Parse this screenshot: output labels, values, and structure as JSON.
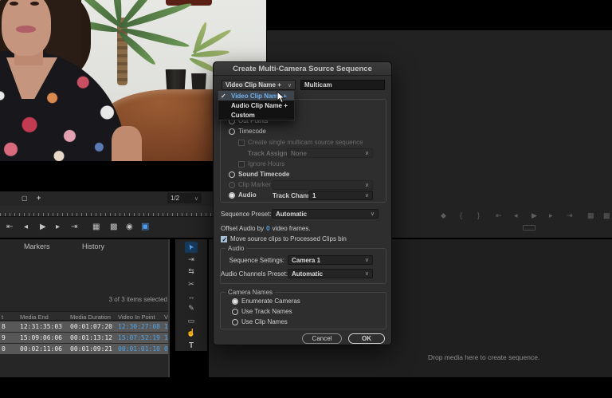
{
  "colors": {
    "accent_blue": "#4fa3e8",
    "menu_highlight_text": "#6fb1ef",
    "row_selected": "#585858",
    "panel": "#232323",
    "dialog": "#2e2e2e"
  },
  "source_monitor": {
    "zoom_value": "1/2",
    "zoom_chevron": "∨",
    "corner_icons": [
      {
        "name": "safe-margins-icon",
        "glyph": "▢"
      },
      {
        "name": "add-marker-icon",
        "glyph": "+"
      }
    ],
    "transport": [
      {
        "name": "jump-to-in",
        "glyph": "⇤"
      },
      {
        "name": "step-back",
        "glyph": "◂"
      },
      {
        "name": "play",
        "glyph": "▶"
      },
      {
        "name": "step-forward",
        "glyph": "▸"
      },
      {
        "name": "jump-to-out",
        "glyph": "⇥"
      },
      {
        "name": "insert",
        "glyph": "▦"
      },
      {
        "name": "overwrite",
        "glyph": "▩"
      },
      {
        "name": "export-frame",
        "glyph": "◉"
      },
      {
        "name": "multicam-view",
        "glyph": "▣"
      }
    ]
  },
  "program_monitor": {
    "transport": [
      {
        "name": "marker",
        "glyph": "◆"
      },
      {
        "name": "mark-in",
        "glyph": "{"
      },
      {
        "name": "mark-out",
        "glyph": "}"
      },
      {
        "name": "jump-to-in",
        "glyph": "⇤"
      },
      {
        "name": "step-back",
        "glyph": "◂"
      },
      {
        "name": "play",
        "glyph": "▶"
      },
      {
        "name": "step-forward",
        "glyph": "▸"
      },
      {
        "name": "jump-to-out",
        "glyph": "⇥"
      },
      {
        "name": "lift",
        "glyph": "▦"
      },
      {
        "name": "extract",
        "glyph": "▩"
      }
    ]
  },
  "project_panel": {
    "tabs": [
      "Markers",
      "History"
    ],
    "selection_status": "3 of 3 items selected",
    "table": {
      "partial_left_header": "t",
      "headers": [
        "Media End",
        "Media Duration",
        "Video In Point"
      ],
      "partial_right_header": "V",
      "rows": [
        {
          "left_partial": "8",
          "media_end": "12:31:35:03",
          "media_duration": "00:01:07:20",
          "video_in_point": "12:30:27:08",
          "right_partial": "1"
        },
        {
          "left_partial": "9",
          "media_end": "15:09:06:06",
          "media_duration": "00:01:13:12",
          "video_in_point": "15:07:52:19",
          "right_partial": "1"
        },
        {
          "left_partial": "0",
          "media_end": "00:02:11:06",
          "media_duration": "00:01:09:21",
          "video_in_point": "00:01:01:10",
          "right_partial": "0"
        }
      ]
    }
  },
  "tools": [
    {
      "name": "selection-tool",
      "glyph": "➤"
    },
    {
      "name": "track-select-forward-tool",
      "glyph": "⇥"
    },
    {
      "name": "ripple-edit-tool",
      "glyph": "⇆"
    },
    {
      "name": "razor-tool",
      "glyph": "✂"
    },
    {
      "name": "slip-tool",
      "glyph": "↔"
    },
    {
      "name": "pen-tool",
      "glyph": "✎"
    },
    {
      "name": "rectangle-tool",
      "glyph": "▭"
    },
    {
      "name": "hand-tool",
      "glyph": "☝"
    },
    {
      "name": "type-tool",
      "glyph": "T"
    }
  ],
  "timeline_panel": {
    "drop_hint": "Drop media here to create sequence."
  },
  "dialog": {
    "title": "Create Multi-Camera Source Sequence",
    "name_dropdown_value": "Video Clip Name +",
    "name_dropdown_chevron": "∨",
    "name_input_value": "Multicam",
    "menu": {
      "check": "✓",
      "items": [
        {
          "label": "Video Clip Name +"
        },
        {
          "label": "Audio Clip Name +"
        },
        {
          "label": "Custom"
        }
      ]
    },
    "sync_group": {
      "out_points": "Out Points",
      "timecode": "Timecode",
      "create_single": "Create single multicam source sequence",
      "track_assignments_label": "Track Assignments:",
      "track_assignments_value": "None",
      "ignore_hours": "Ignore Hours",
      "sound_timecode": "Sound Timecode",
      "clip_marker": "Clip Marker",
      "audio": "Audio",
      "track_channel_label": "Track Channel",
      "track_channel_value": "1"
    },
    "sequence_preset_label": "Sequence Preset:",
    "sequence_preset_value": "Automatic",
    "offset_prefix": "Offset Audio by",
    "offset_value": "0",
    "offset_suffix": "video frames.",
    "move_source_label": "Move source clips to Processed Clips bin",
    "audio_group": {
      "label": "Audio",
      "sequence_settings_label": "Sequence Settings:",
      "sequence_settings_value": "Camera 1",
      "channels_label": "Audio Channels Preset:",
      "channels_value": "Automatic"
    },
    "camera_group": {
      "label": "Camera Names",
      "options": [
        "Enumerate Cameras",
        "Use Track Names",
        "Use Clip Names"
      ]
    },
    "cancel_label": "Cancel",
    "ok_label": "OK"
  }
}
